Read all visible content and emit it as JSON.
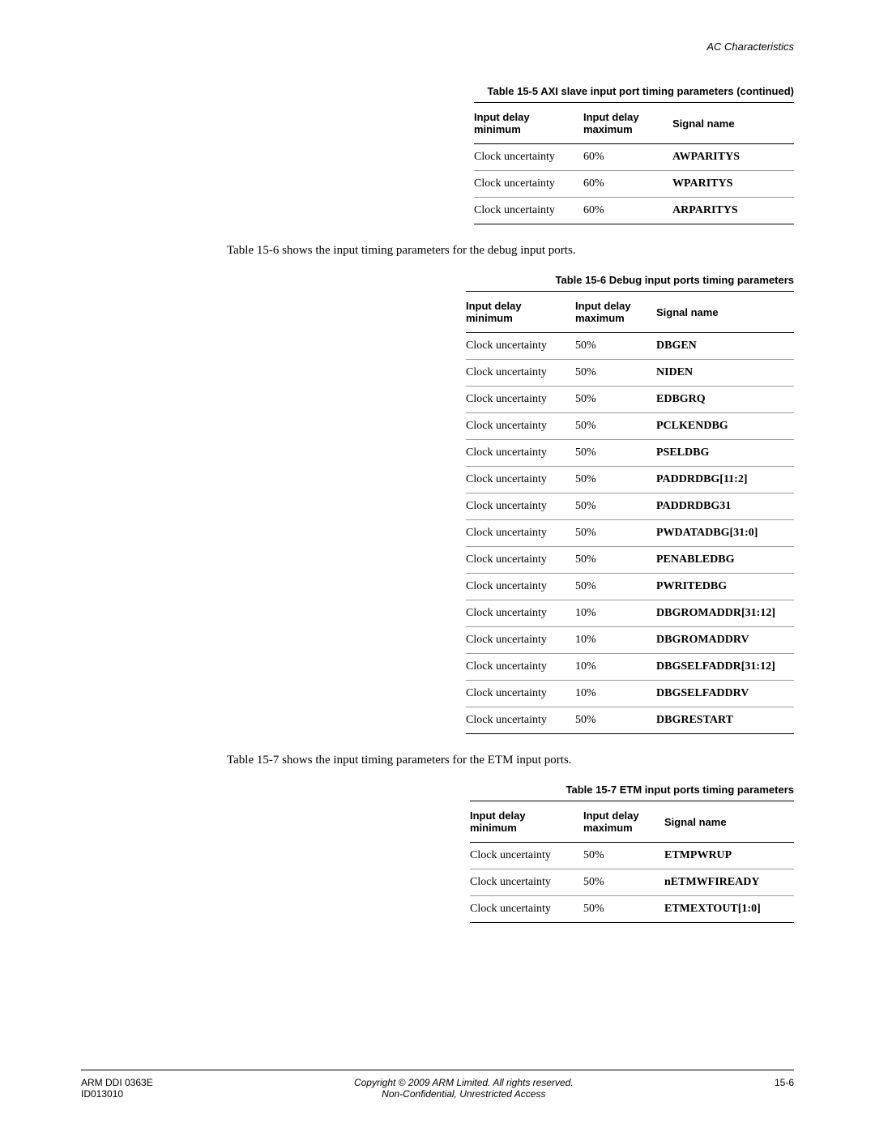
{
  "header": {
    "section": "AC Characteristics"
  },
  "table1": {
    "caption": "Table 15-5 AXI slave input port timing parameters (continued)",
    "headers": {
      "col1": "Input delay minimum",
      "col2": "Input delay maximum",
      "col3": "Signal name"
    },
    "rows": [
      {
        "min": "Clock uncertainty",
        "max": "60%",
        "sig": "AWPARITYS"
      },
      {
        "min": "Clock uncertainty",
        "max": "60%",
        "sig": "WPARITYS"
      },
      {
        "min": "Clock uncertainty",
        "max": "60%",
        "sig": "ARPARITYS"
      }
    ]
  },
  "text1": "Table 15-6 shows the input timing parameters for the debug input ports.",
  "table2": {
    "caption": "Table 15-6 Debug input ports timing parameters",
    "headers": {
      "col1": "Input delay minimum",
      "col2": "Input delay maximum",
      "col3": "Signal name"
    },
    "rows": [
      {
        "min": "Clock uncertainty",
        "max": "50%",
        "sig": "DBGEN"
      },
      {
        "min": "Clock uncertainty",
        "max": "50%",
        "sig": "NIDEN"
      },
      {
        "min": "Clock uncertainty",
        "max": "50%",
        "sig": "EDBGRQ"
      },
      {
        "min": "Clock uncertainty",
        "max": "50%",
        "sig": "PCLKENDBG"
      },
      {
        "min": "Clock uncertainty",
        "max": "50%",
        "sig": "PSELDBG"
      },
      {
        "min": "Clock uncertainty",
        "max": "50%",
        "sig": "PADDRDBG[11:2]"
      },
      {
        "min": "Clock uncertainty",
        "max": "50%",
        "sig": "PADDRDBG31"
      },
      {
        "min": "Clock uncertainty",
        "max": "50%",
        "sig": "PWDATADBG[31:0]"
      },
      {
        "min": "Clock uncertainty",
        "max": "50%",
        "sig": "PENABLEDBG"
      },
      {
        "min": "Clock uncertainty",
        "max": "50%",
        "sig": "PWRITEDBG"
      },
      {
        "min": "Clock uncertainty",
        "max": "10%",
        "sig": "DBGROMADDR[31:12]"
      },
      {
        "min": "Clock uncertainty",
        "max": "10%",
        "sig": "DBGROMADDRV"
      },
      {
        "min": "Clock uncertainty",
        "max": "10%",
        "sig": "DBGSELFADDR[31:12]"
      },
      {
        "min": "Clock uncertainty",
        "max": "10%",
        "sig": "DBGSELFADDRV"
      },
      {
        "min": "Clock uncertainty",
        "max": "50%",
        "sig": "DBGRESTART"
      }
    ]
  },
  "text2": "Table 15-7 shows the input timing parameters for the ETM input ports.",
  "table3": {
    "caption": "Table 15-7 ETM input ports timing parameters",
    "headers": {
      "col1": "Input delay minimum",
      "col2": "Input delay maximum",
      "col3": "Signal name"
    },
    "rows": [
      {
        "min": "Clock uncertainty",
        "max": "50%",
        "sig": "ETMPWRUP"
      },
      {
        "min": "Clock uncertainty",
        "max": "50%",
        "sig": "nETMWFIREADY"
      },
      {
        "min": "Clock uncertainty",
        "max": "50%",
        "sig": "ETMEXTOUT[1:0]"
      }
    ]
  },
  "footer": {
    "left1": "ARM DDI 0363E",
    "left2": "ID013010",
    "center1": "Copyright © 2009 ARM Limited. All rights reserved.",
    "center2": "Non-Confidential, Unrestricted Access",
    "right": "15-6"
  }
}
